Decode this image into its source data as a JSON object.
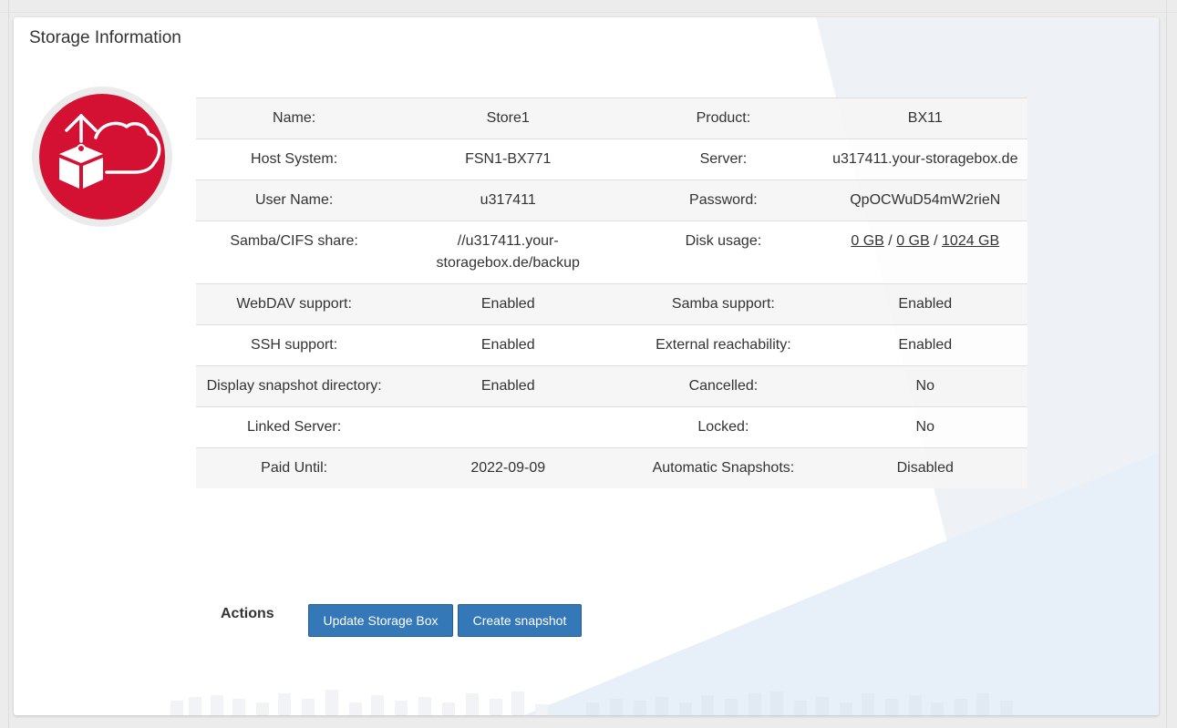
{
  "panel": {
    "title": "Storage Information"
  },
  "rows": [
    {
      "l1": "Name:",
      "v1": "Store1",
      "l2": "Product:",
      "v2": "BX11"
    },
    {
      "l1": "Host System:",
      "v1": "FSN1-BX771",
      "l2": "Server:",
      "v2": "u317411.your-storagebox.de"
    },
    {
      "l1": "User Name:",
      "v1": "u317411",
      "l2": "Password:",
      "v2": "QpOCWuD54mW2rieN"
    },
    {
      "l1": "Samba/CIFS share:",
      "v1": "//u317411.your-storagebox.de/backup",
      "l2": "Disk usage:",
      "v2": ""
    },
    {
      "l1": "WebDAV support:",
      "v1": "Enabled",
      "l2": "Samba support:",
      "v2": "Enabled"
    },
    {
      "l1": "SSH support:",
      "v1": "Enabled",
      "l2": "External reachability:",
      "v2": "Enabled"
    },
    {
      "l1": "Display snapshot directory:",
      "v1": "Enabled",
      "l2": "Cancelled:",
      "v2": "No"
    },
    {
      "l1": "Linked Server:",
      "v1": "",
      "l2": "Locked:",
      "v2": "No"
    },
    {
      "l1": "Paid Until:",
      "v1": "2022-09-09",
      "l2": "Automatic Snapshots:",
      "v2": "Disabled"
    }
  ],
  "disk_usage": {
    "used": "0 GB",
    "snapshots": "0 GB",
    "total": "1024 GB",
    "separator": "/"
  },
  "actions": {
    "label": "Actions",
    "update_button": "Update Storage Box",
    "snapshot_button": "Create snapshot"
  },
  "colors": {
    "brand_red": "#d41133",
    "button_blue": "#3478b8"
  },
  "icons": {
    "logo": "storage-box-cloud-icon"
  }
}
